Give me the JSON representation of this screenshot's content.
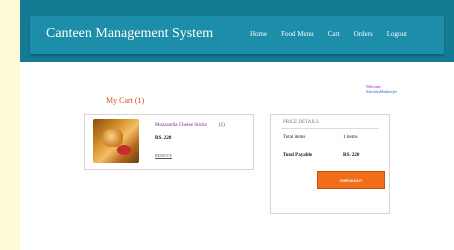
{
  "header": {
    "brand": "Canteen Management System",
    "nav": {
      "home": "Home",
      "food_menu": "Food Menu",
      "cart": "Cart",
      "orders": "Orders",
      "logout": "Logout"
    }
  },
  "welcome": {
    "greeting": "Welcome",
    "username": "SukshitaMukherjee"
  },
  "cart": {
    "title": "My Cart (1)",
    "items": [
      {
        "name": "Mozzarella Cheese Sticks",
        "quantity": "(1)",
        "price": "RS. 220",
        "remove_label": "REMOVE"
      }
    ]
  },
  "price_details": {
    "title": "PRICE DETAILS",
    "total_items_label": "Total items",
    "total_items_value": "1 items",
    "total_payable_label": "Total Payable",
    "total_payable_value": "RS. 220",
    "checkout_label": "CHECKOUT"
  },
  "colors": {
    "header_band": "#157a93",
    "navbar": "#1d8eaa",
    "side_strip": "#fdfbd6",
    "cart_title": "#d14b1f",
    "item_name": "#7b1fa2",
    "checkout": "#f16d1a"
  }
}
